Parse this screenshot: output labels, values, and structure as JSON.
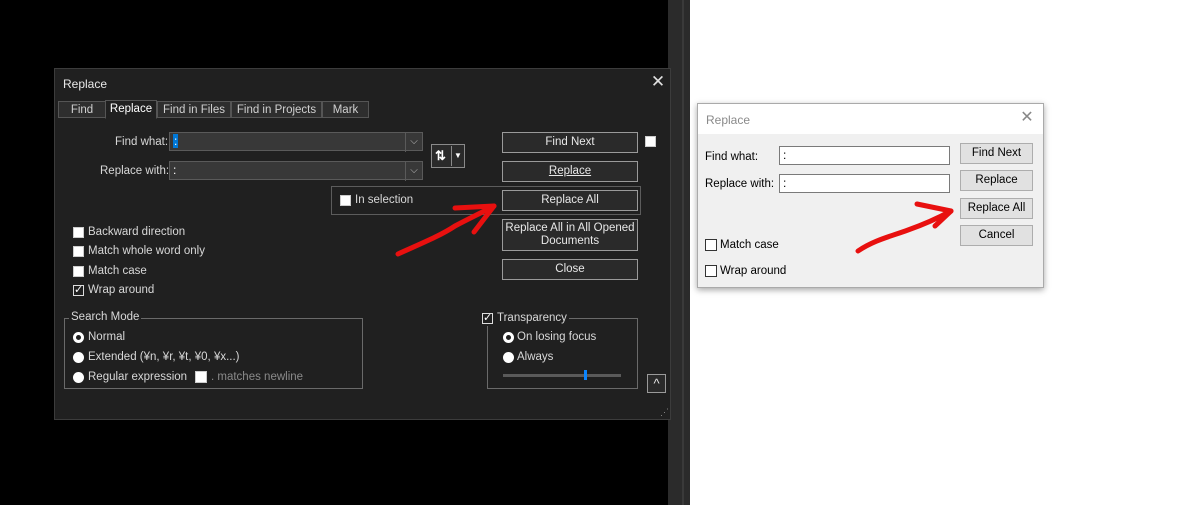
{
  "dark_dialog": {
    "title": "Replace",
    "tabs": [
      "Find",
      "Replace",
      "Find in Files",
      "Find in Projects",
      "Mark"
    ],
    "find_what_label": "Find what:",
    "find_what_value": ":",
    "replace_with_label": "Replace with:",
    "replace_with_value": ":",
    "in_selection_label": "In selection",
    "buttons": {
      "find_next": "Find Next",
      "replace": "Replace",
      "replace_all": "Replace All",
      "replace_all_opened_line1": "Replace All in All Opened",
      "replace_all_opened_line2": "Documents",
      "close": "Close"
    },
    "options": {
      "backward": "Backward direction",
      "whole_word": "Match whole word only",
      "match_case": "Match case",
      "wrap_around": "Wrap around",
      "wrap_around_checked": true
    },
    "search_mode": {
      "label": "Search Mode",
      "normal": "Normal",
      "extended": "Extended (¥n, ¥r, ¥t, ¥0, ¥x...)",
      "regex": "Regular expression",
      "matches_newline": ". matches newline",
      "selected": "Normal"
    },
    "transparency": {
      "label": "Transparency",
      "checked": true,
      "on_losing_focus": "On losing focus",
      "always": "Always",
      "selected": "On losing focus",
      "slider_level": 0.7
    },
    "collapse_button": "^"
  },
  "light_dialog": {
    "title": "Replace",
    "find_what_label": "Find what:",
    "find_what_value": ":",
    "replace_with_label": "Replace with:",
    "replace_with_value": ":",
    "buttons": {
      "find_next": "Find Next",
      "replace": "Replace",
      "replace_all": "Replace All",
      "cancel": "Cancel"
    },
    "match_case": "Match case",
    "wrap_around": "Wrap around"
  },
  "colors": {
    "annotation_arrow": "#e8100f",
    "dark_background": "#202020",
    "accent_blue": "#0078d7"
  }
}
